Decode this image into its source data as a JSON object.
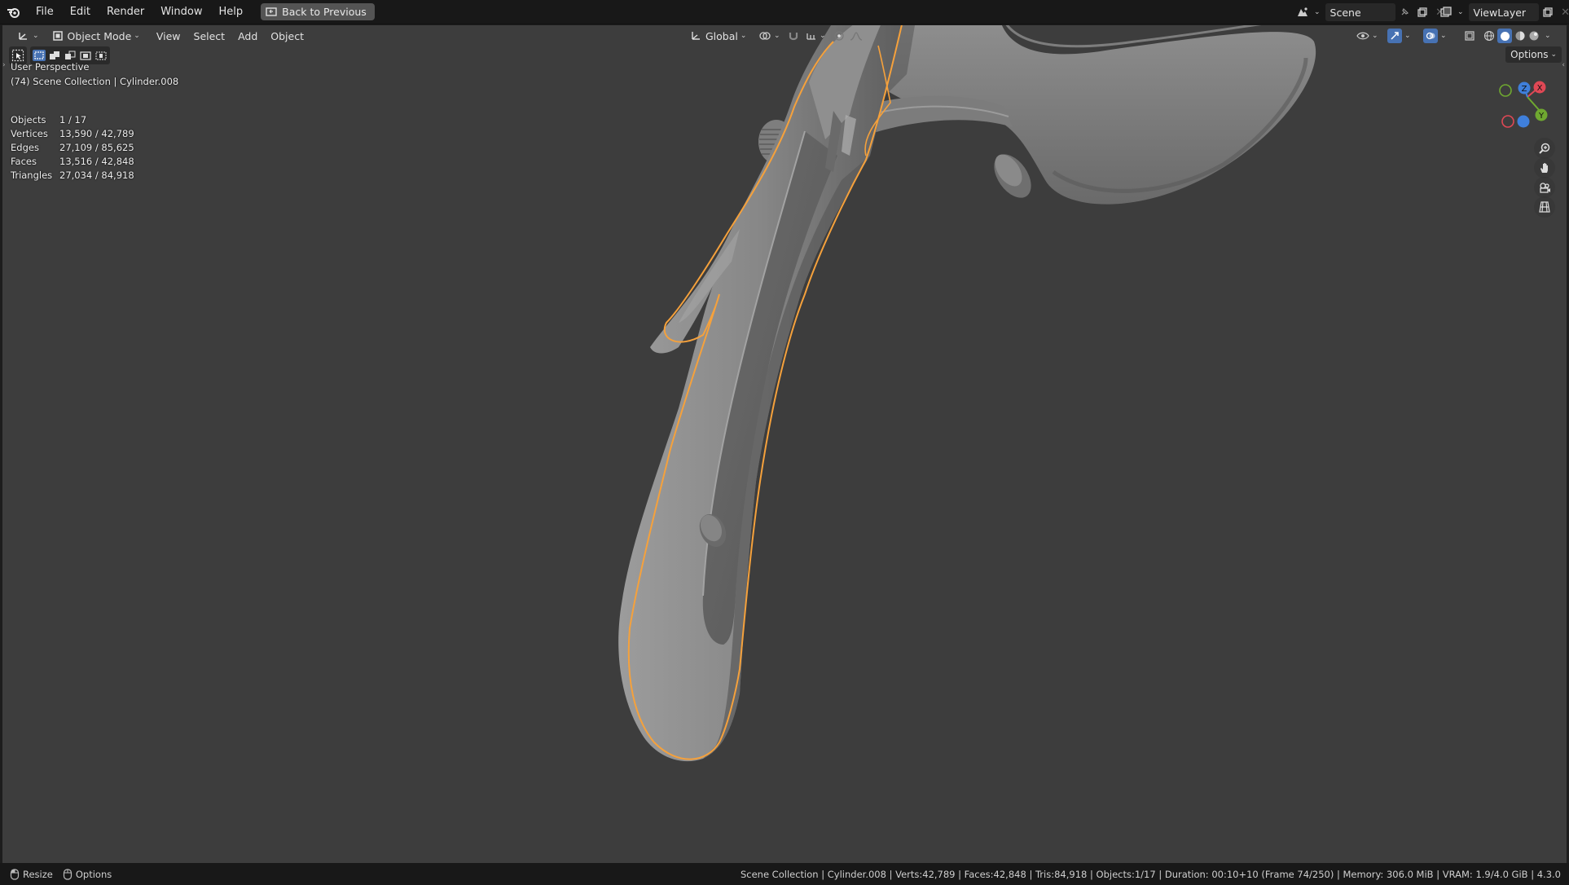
{
  "menubar": {
    "items": [
      "File",
      "Edit",
      "Render",
      "Window",
      "Help"
    ],
    "back_button": "Back to Previous",
    "scene": "Scene",
    "view_layer": "ViewLayer"
  },
  "viewport_header": {
    "mode": "Object Mode",
    "menus": [
      "View",
      "Select",
      "Add",
      "Object"
    ],
    "transform_orientation": "Global",
    "options": "Options"
  },
  "overlay_info": {
    "view_name": "User Perspective",
    "collection_line": "(74) Scene Collection | Cylinder.008"
  },
  "stats": [
    {
      "label": "Objects",
      "value": "1 / 17"
    },
    {
      "label": "Vertices",
      "value": "13,590 / 42,789"
    },
    {
      "label": "Edges",
      "value": "27,109 / 85,625"
    },
    {
      "label": "Faces",
      "value": "13,516 / 42,848"
    },
    {
      "label": "Triangles",
      "value": "27,034 / 84,918"
    }
  ],
  "gizmo": {
    "x": "X",
    "y": "Y",
    "z": "Z",
    "x_color": "#e04855",
    "y_color": "#6fa830",
    "z_color": "#3f7fdb"
  },
  "statusbar": {
    "left": [
      {
        "label": "Resize",
        "icon": "mouse-icon"
      },
      {
        "label": "Options",
        "icon": "mouse-icon"
      }
    ],
    "right": "Scene Collection | Cylinder.008 | Verts:42,789 | Faces:42,848 | Tris:84,918 | Objects:1/17 | Duration: 00:10+10 (Frame 74/250) | Memory: 306.0 MiB | VRAM: 1.9/4.0 GiB | 4.3.0"
  },
  "colors": {
    "viewport_bg": "#3d3d3d",
    "selection_outline": "#f5a13c",
    "accent_blue": "#4772b3"
  }
}
